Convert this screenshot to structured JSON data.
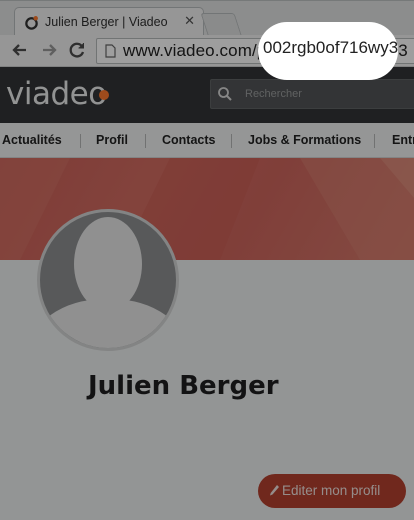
{
  "browser": {
    "tab_title": "Julien Berger | Viadeo",
    "tab_close_glyph": "✕",
    "url_prefix": "www.viadeo.com/p/",
    "url_highlight": "002rgb0of716wy3"
  },
  "site": {
    "logo_text": "viadeo",
    "accent_color": "#ff7a2e",
    "search_placeholder": "Rechercher"
  },
  "nav": {
    "items": [
      "Actualités",
      "Profil",
      "Contacts",
      "Jobs & Formations",
      "Entr"
    ]
  },
  "profile": {
    "name": "Julien Berger",
    "edit_label": "Editer mon profil"
  }
}
